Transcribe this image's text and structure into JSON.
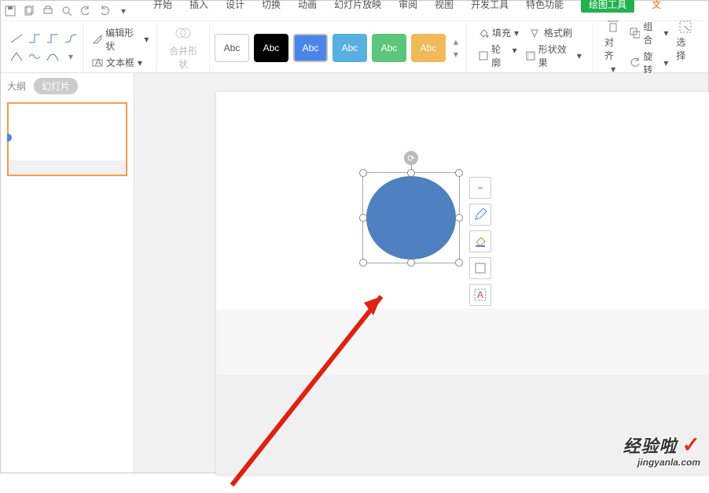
{
  "quick_access": {
    "icons": [
      "save",
      "print",
      "preview",
      "undo",
      "redo"
    ]
  },
  "tabs": {
    "start": "开始",
    "insert": "插入",
    "design": "设计",
    "transition": "切换",
    "animate": "动画",
    "slideshow": "幻灯片放映",
    "review": "审阅",
    "view": "视图",
    "dev": "开发工具",
    "feature": "特色功能",
    "drawing": "绘图工具",
    "text": "文"
  },
  "ribbon": {
    "edit_shape": "编辑形状",
    "text_box": "文本框",
    "merge_shapes": "合并形状",
    "style_label": "Abc",
    "fill": "填充",
    "format_painter": "格式刷",
    "outline": "轮廓",
    "shape_effects": "形状效果",
    "align": "对齐",
    "group": "组合",
    "rotate": "旋转",
    "select": "选择"
  },
  "left_pane": {
    "outline": "大纲",
    "slides": "幻灯片"
  },
  "float_tools": {
    "t1": "minus",
    "t2": "pencil",
    "t3": "bucket",
    "t4": "rect",
    "t5": "textfx"
  },
  "watermark": {
    "brand": "经验啦",
    "url": "jingyanla.com"
  }
}
